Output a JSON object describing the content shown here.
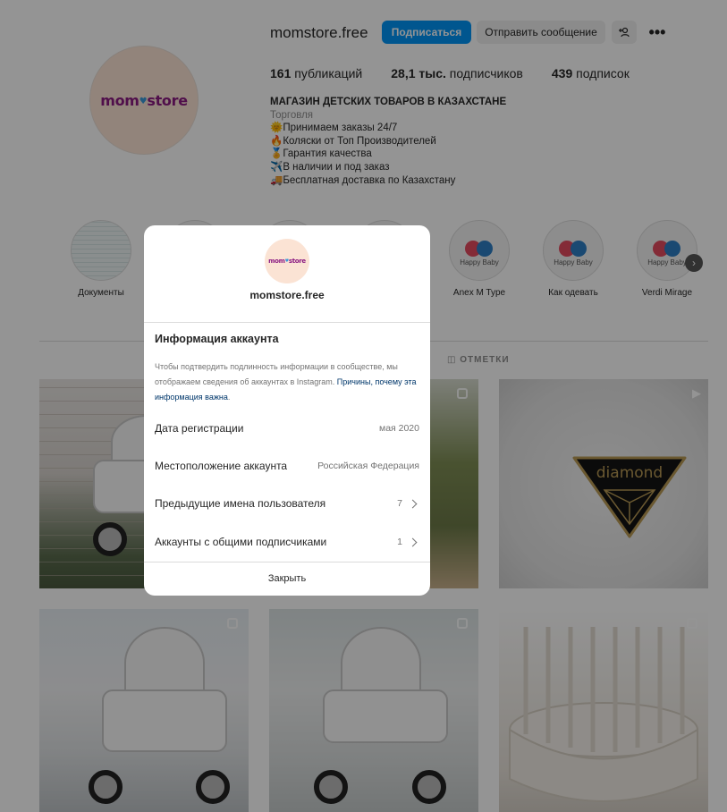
{
  "profile": {
    "username": "momstore.free",
    "logo_text_left": "mom",
    "logo_heart": "♥",
    "logo_text_right": "store",
    "follow_label": "Подписаться",
    "message_label": "Отправить сообщение",
    "add_user_icon": "+",
    "more_icon": "•••",
    "posts_count": "161",
    "posts_label": "публикаций",
    "followers_count": "28,1 тыс.",
    "followers_label": "подписчиков",
    "following_count": "439",
    "following_label": "подписок",
    "bio_name": "МАГАЗИН ДЕТСКИХ ТОВАРОВ В КАЗАХСТАНЕ",
    "bio_category": "Торговля",
    "bio_lines": [
      "🌞Принимаем заказы 24/7",
      "🔥Коляски от Топ Производителей",
      "🏅Гарантия качества",
      "✈️В наличии и под заказ",
      "🚚Бесплатная доставка по Казахстану"
    ]
  },
  "highlights": [
    {
      "label": "Документы",
      "brand": ""
    },
    {
      "label": "Anex M Type",
      "brand": "Happy Baby"
    },
    {
      "label": "Как одевать",
      "brand": "Happy Baby"
    },
    {
      "label": "Verdi Mirage",
      "brand": "Happy Baby"
    }
  ],
  "tabs": {
    "tagged_label": "ОТМЕТКИ"
  },
  "posts": {
    "badge_text": "diamond"
  },
  "modal": {
    "username": "momstore.free",
    "title": "Информация аккаунта",
    "desc_text": "Чтобы подтвердить подлинность информации в сообществе, мы отображаем сведения об аккаунтах в Instagram. ",
    "desc_link": "Причины, почему эта информация важна",
    "desc_end": ".",
    "rows": [
      {
        "label": "Дата регистрации",
        "value": "мая 2020"
      },
      {
        "label": "Местоположение аккаунта",
        "value": "Российская Федерация"
      },
      {
        "label": "Предыдущие имена пользователя",
        "value": "7"
      },
      {
        "label": "Аккаунты с общими подписчиками",
        "value": "1"
      }
    ],
    "close_label": "Закрыть"
  }
}
